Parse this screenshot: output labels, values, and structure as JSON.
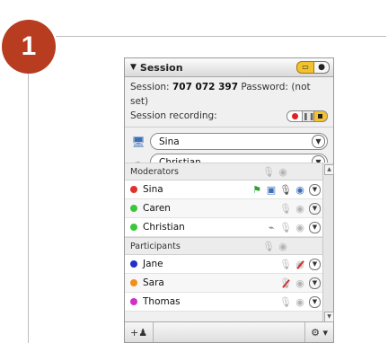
{
  "step_number": "1",
  "panel": {
    "title": "Session",
    "session_label": "Session:",
    "session_id": "707 072 397",
    "password_label": "Password:",
    "password_value": "(not set)",
    "recording_label": "Session recording:",
    "presenter": "Sina",
    "keyboard_mouse": "Christian",
    "groups": [
      {
        "name": "Moderators",
        "people": [
          {
            "name": "Sina",
            "color": "#e03030",
            "icons": [
              "flag-icon",
              "screen-icon",
              "mic-icon",
              "webcam-icon"
            ]
          },
          {
            "name": "Caren",
            "color": "#3cc63c",
            "icons": [
              "mic-icon",
              "webcam-icon"
            ]
          },
          {
            "name": "Christian",
            "color": "#3cc63c",
            "icons": [
              "mouse-icon",
              "mic-icon",
              "webcam-icon"
            ]
          }
        ]
      },
      {
        "name": "Participants",
        "people": [
          {
            "name": "Jane",
            "color": "#2030c8",
            "icons": [
              "mic-icon",
              "webcam-off-icon"
            ]
          },
          {
            "name": "Sara",
            "color": "#f0901a",
            "icons": [
              "mic-off-icon",
              "webcam-icon"
            ]
          },
          {
            "name": "Thomas",
            "color": "#d030c8",
            "icons": [
              "mic-icon",
              "webcam-icon"
            ]
          }
        ]
      }
    ]
  },
  "colors": {
    "badge": "#b83c1f",
    "record": "#e02222",
    "accent": "#f2c230"
  }
}
